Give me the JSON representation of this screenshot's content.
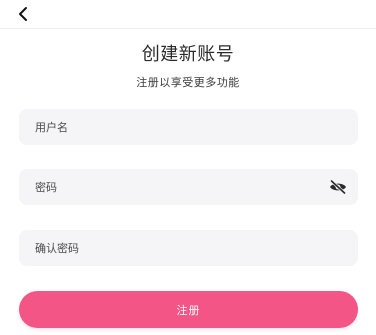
{
  "header": {
    "back_icon": "chevron-left-icon"
  },
  "page": {
    "title": "创建新账号",
    "subtitle": "注册以享受更多功能"
  },
  "form": {
    "username": {
      "placeholder": "用户名",
      "value": ""
    },
    "password": {
      "placeholder": "密码",
      "value": "",
      "visibility_icon": "eye-off-icon"
    },
    "confirm_password": {
      "placeholder": "确认密码",
      "value": ""
    },
    "submit_label": "注册"
  },
  "colors": {
    "accent": "#f25586",
    "field_bg": "#f5f5f7",
    "title_text": "#2b2b2b"
  }
}
